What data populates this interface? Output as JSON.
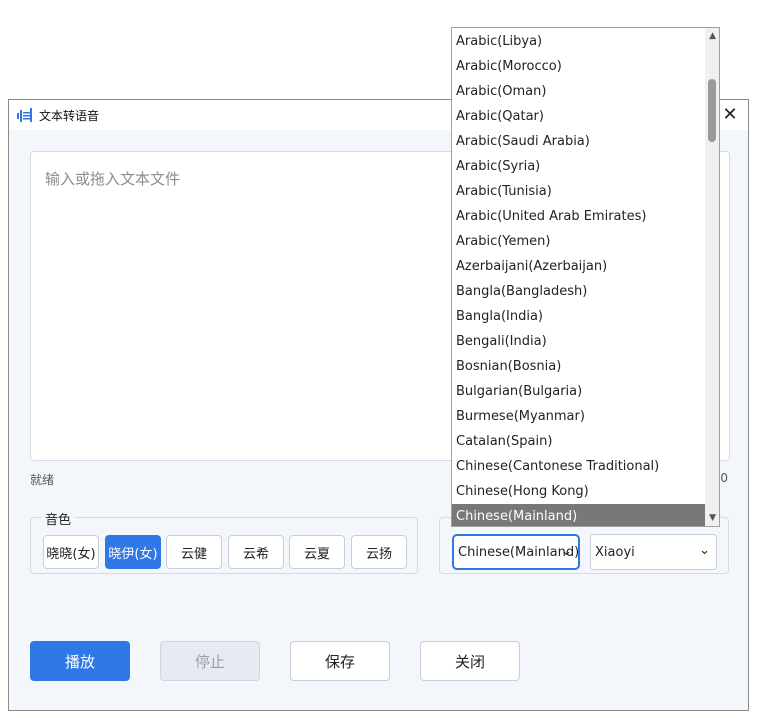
{
  "window": {
    "title": "文本转语音",
    "close_label": "✕"
  },
  "editor": {
    "placeholder": "输入或拖入文本文件"
  },
  "status": {
    "text": "就绪",
    "count": "0"
  },
  "voices": {
    "legend": "音色",
    "items": [
      {
        "label": "晓晓(女)",
        "active": false
      },
      {
        "label": "晓伊(女)",
        "active": true
      },
      {
        "label": "云健",
        "active": false
      },
      {
        "label": "云希",
        "active": false
      },
      {
        "label": "云夏",
        "active": false
      },
      {
        "label": "云扬",
        "active": false
      }
    ]
  },
  "language": {
    "selected": "Chinese(Mainland)",
    "voice_selected": "Xiaoyi",
    "options": [
      "Arabic(Libya)",
      "Arabic(Morocco)",
      "Arabic(Oman)",
      "Arabic(Qatar)",
      "Arabic(Saudi Arabia)",
      "Arabic(Syria)",
      "Arabic(Tunisia)",
      "Arabic(United Arab Emirates)",
      "Arabic(Yemen)",
      "Azerbaijani(Azerbaijan)",
      "Bangla(Bangladesh)",
      "Bangla(India)",
      "Bengali(India)",
      "Bosnian(Bosnia)",
      "Bulgarian(Bulgaria)",
      "Burmese(Myanmar)",
      "Catalan(Spain)",
      "Chinese(Cantonese Traditional)",
      "Chinese(Hong Kong)",
      "Chinese(Mainland)"
    ]
  },
  "actions": {
    "play": "播放",
    "stop": "停止",
    "save": "保存",
    "close": "关闭"
  },
  "colors": {
    "accent": "#2f78e6",
    "window_bg": "#f3f6fb",
    "selected_option_bg": "#787878"
  }
}
